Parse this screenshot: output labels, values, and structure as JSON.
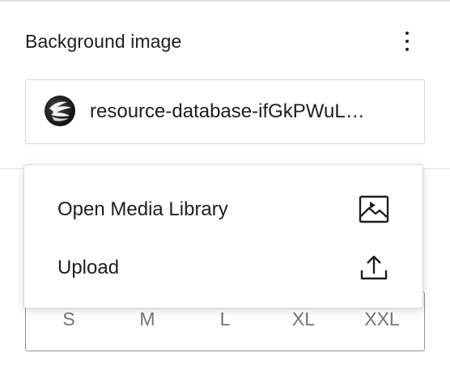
{
  "panel": {
    "title": "Background image"
  },
  "file": {
    "name": "resource-database-ifGkPWuL…"
  },
  "menu": {
    "items": [
      {
        "label": "Open Media Library",
        "icon": "media-library-icon"
      },
      {
        "label": "Upload",
        "icon": "upload-icon"
      }
    ]
  },
  "sizes": {
    "options": [
      "S",
      "M",
      "L",
      "XL",
      "XXL"
    ]
  }
}
